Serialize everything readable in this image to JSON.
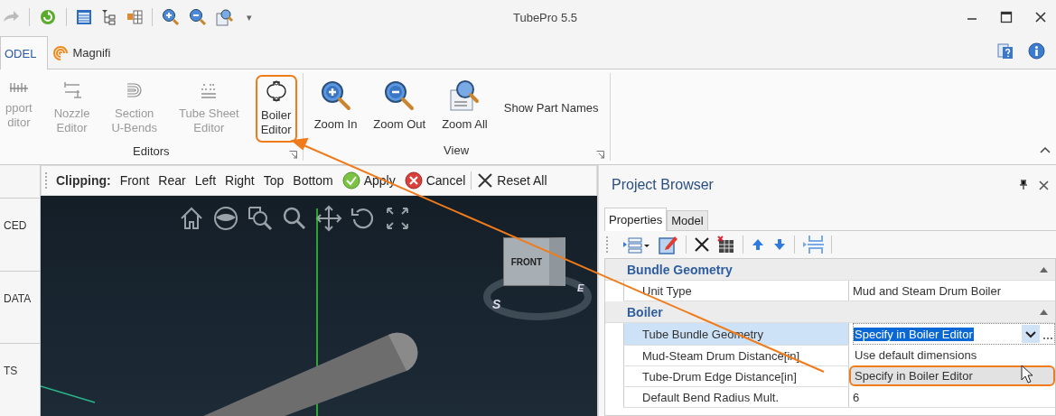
{
  "window": {
    "title": "TubePro 5.5"
  },
  "quick_access": {
    "menu_glyph": "▾"
  },
  "tabs": [
    {
      "label": "ODEL",
      "selected": true
    },
    {
      "label": "Magnifi",
      "selected": false
    }
  ],
  "ribbon": {
    "groups": [
      {
        "label": "Editors",
        "buttons": [
          {
            "kind": "support",
            "lines": [
              "pport",
              "ditor"
            ],
            "disabled": true,
            "highlighted": false
          },
          {
            "kind": "nozzle",
            "lines": [
              "Nozzle",
              "Editor"
            ],
            "disabled": true,
            "highlighted": false
          },
          {
            "kind": "ubend",
            "lines": [
              "Section",
              "U-Bends"
            ],
            "disabled": true,
            "highlighted": false
          },
          {
            "kind": "tubesheet",
            "lines": [
              "Tube Sheet",
              "Editor"
            ],
            "disabled": true,
            "highlighted": false
          },
          {
            "kind": "boiler",
            "lines": [
              "Boiler",
              "Editor"
            ],
            "disabled": false,
            "highlighted": true
          }
        ]
      },
      {
        "label": "View",
        "buttons": [
          {
            "kind": "zoomin",
            "lines": [
              "Zoom In"
            ],
            "disabled": false,
            "highlighted": false
          },
          {
            "kind": "zoomout",
            "lines": [
              "Zoom Out"
            ],
            "disabled": false,
            "highlighted": false
          },
          {
            "kind": "zoomall",
            "lines": [
              "Zoom All"
            ],
            "disabled": false,
            "highlighted": false
          },
          {
            "kind": "text",
            "lines": [
              "Show Part Names"
            ],
            "disabled": false,
            "highlighted": false
          }
        ]
      }
    ]
  },
  "side_tabs": [
    "CED",
    "DATA",
    "TS"
  ],
  "clipping_toolbar": {
    "label": "Clipping:",
    "items": [
      {
        "kind": "text",
        "label": "Front"
      },
      {
        "kind": "text",
        "label": "Rear"
      },
      {
        "kind": "text",
        "label": "Left"
      },
      {
        "kind": "text",
        "label": "Right"
      },
      {
        "kind": "text",
        "label": "Top"
      },
      {
        "kind": "text",
        "label": "Bottom"
      },
      {
        "kind": "apply",
        "label": "Apply"
      },
      {
        "kind": "cancel",
        "label": "Cancel"
      },
      {
        "kind": "reset",
        "label": "Reset All"
      }
    ]
  },
  "viewport": {
    "view_cube": {
      "face": "FRONT",
      "compass": [
        "S",
        "E"
      ]
    }
  },
  "project_browser": {
    "title": "Project Browser",
    "tabs": [
      {
        "label": "Properties",
        "selected": true
      },
      {
        "label": "Model",
        "selected": false
      }
    ],
    "categories": [
      {
        "name": "Bundle Geometry",
        "expanded": true,
        "rows": [
          {
            "name": "Unit Type",
            "value": "Mud and Steam Drum Boiler",
            "selected": false
          }
        ]
      },
      {
        "name": "Boiler",
        "expanded": true,
        "rows": [
          {
            "name": "Tube Bundle Geometry",
            "value": "Specify in Boiler Editor",
            "selected": true,
            "dropdown": [
              {
                "label": "Use default dimensions",
                "highlighted": false
              },
              {
                "label": "Specify in Boiler Editor",
                "highlighted": true
              }
            ]
          },
          {
            "name": "Mud-Steam Drum Distance[in]",
            "selected": false
          },
          {
            "name": "Tube-Drum Edge Distance[in]",
            "selected": false
          },
          {
            "name": "Default Bend Radius Mult.",
            "value": "6",
            "selected": false
          }
        ]
      }
    ]
  }
}
